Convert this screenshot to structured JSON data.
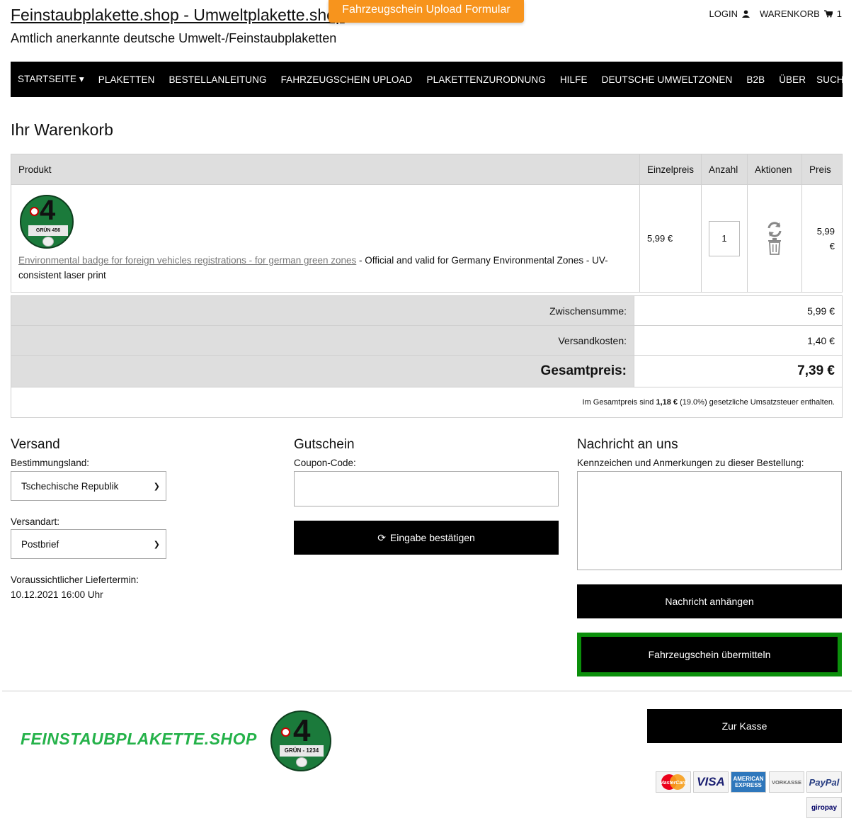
{
  "header": {
    "site_title": "Feinstaubplakette.shop - Umweltplakette.shop",
    "subtitle": "Amtlich anerkannte deutsche Umwelt-/Feinstaubplaketten",
    "upload_tab": "Fahrzeugschein Upload Formular",
    "login": "LOGIN",
    "cart": "WARENKORB",
    "cart_count": "1"
  },
  "nav": {
    "items": [
      "STARTSEITE",
      "PLAKETTEN",
      "BESTELLANLEITUNG",
      "FAHRZEUGSCHEIN UPLOAD",
      "PLAKETTENZURODNUNG",
      "HILFE",
      "DEUTSCHE UMWELTZONEN",
      "B2B",
      "ÜBER",
      "SUCHEN..."
    ]
  },
  "page_title": "Ihr Warenkorb",
  "cart_table": {
    "headers": {
      "product": "Produkt",
      "unit_price": "Einzelpreis",
      "quantity": "Anzahl",
      "actions": "Aktionen",
      "price": "Preis"
    },
    "row": {
      "badge_number": "4",
      "badge_plate": "GRÜN 456",
      "product_link": "Environmental badge for foreign vehicles registrations - for german green zones",
      "product_desc": " - Official and valid for Germany Environmental Zones - UV-consistent laser print",
      "unit_price": "5,99 €",
      "quantity": "1",
      "price": "5,99 €"
    }
  },
  "totals": {
    "subtotal_label": "Zwischensumme:",
    "subtotal": "5,99 €",
    "shipping_label": "Versandkosten:",
    "shipping": "1,40 €",
    "total_label": "Gesamtpreis:",
    "total": "7,39 €",
    "tax_prefix": "Im Gesamtpreis sind ",
    "tax_amount": "1,18 €",
    "tax_suffix": " (19.0%) gesetzliche Umsatzsteuer enthalten."
  },
  "shipping": {
    "heading": "Versand",
    "country_label": "Bestimmungsland:",
    "country_value": "Tschechische Republik",
    "method_label": "Versandart:",
    "method_value": "Postbrief",
    "delivery_label": "Voraussichtlicher Liefertermin:",
    "delivery_value": "10.12.2021 16:00 Uhr"
  },
  "coupon": {
    "heading": "Gutschein",
    "label": "Coupon-Code:",
    "button": "Eingabe bestätigen"
  },
  "message": {
    "heading": "Nachricht an uns",
    "label": "Kennzeichen und Anmerkungen zu dieser Bestellung:",
    "attach_button": "Nachricht anhängen",
    "vehicle_button": "Fahrzeugschein übermitteln"
  },
  "footer": {
    "logo_text": "FEINSTAUBPLAKETTE.SHOP",
    "badge_number": "4",
    "badge_plate": "GRÜN - 1234",
    "checkout_button": "Zur Kasse",
    "payments": [
      "MasterCard",
      "VISA",
      "AMERICAN EXPRESS",
      "VORKASSE",
      "PayPal",
      "giropay"
    ]
  },
  "colors": {
    "accent_orange": "#f7941d",
    "nav_black": "#000000",
    "green": "#0b8f0b",
    "logo_green": "#25b24a"
  }
}
